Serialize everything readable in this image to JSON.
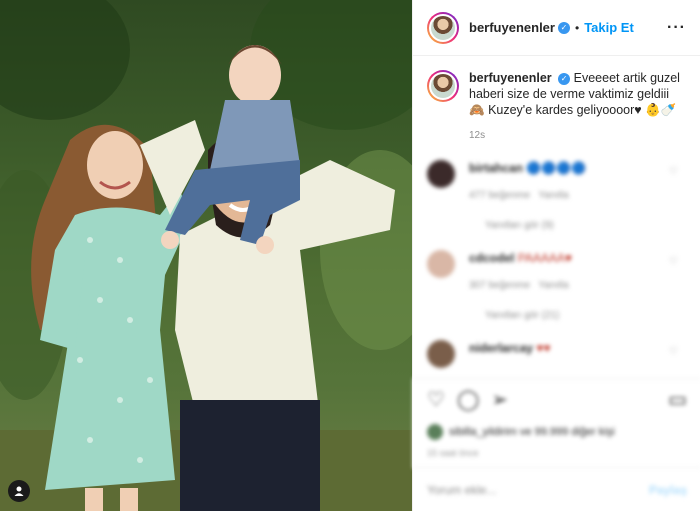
{
  "header": {
    "username": "berfuyenenler",
    "follow_label": "Takip Et"
  },
  "caption": {
    "username": "berfuyenenler",
    "line1": "Eveeeet artik guzel",
    "line2": "haberi size de verme vaktimiz geldiii",
    "line3": "Kuzey'e kardes geliyoooor♥",
    "time": "12s"
  },
  "comments": [
    {
      "user": "birtahcan",
      "text": "🔵🔵🔵🔵",
      "likes": "477 beğenme",
      "reply": "Yanıtla",
      "replies": "Yanıtları gör (9)",
      "avatar_color": "#3b2a2a"
    },
    {
      "user": "cdcodel",
      "text": "PAAAAA♥",
      "likes": "307 beğenme",
      "reply": "Yanıtla",
      "replies": "Yanıtları gör (21)",
      "avatar_color": "#d9b7a6"
    },
    {
      "user": "niderlarcay",
      "text": "♥♥",
      "likes": "",
      "reply": "",
      "replies": "",
      "avatar_color": "#7a5e4a"
    }
  ],
  "actions": {
    "likes_text": "sibilla_yildirim ve 99.999 diğer kişi",
    "date_text": "15 saat önce"
  },
  "add_comment": {
    "placeholder": "Yorum ekle...",
    "post_label": "Paylaş"
  },
  "colors": {
    "accent": "#0095f6",
    "verified": "#3897f0"
  }
}
